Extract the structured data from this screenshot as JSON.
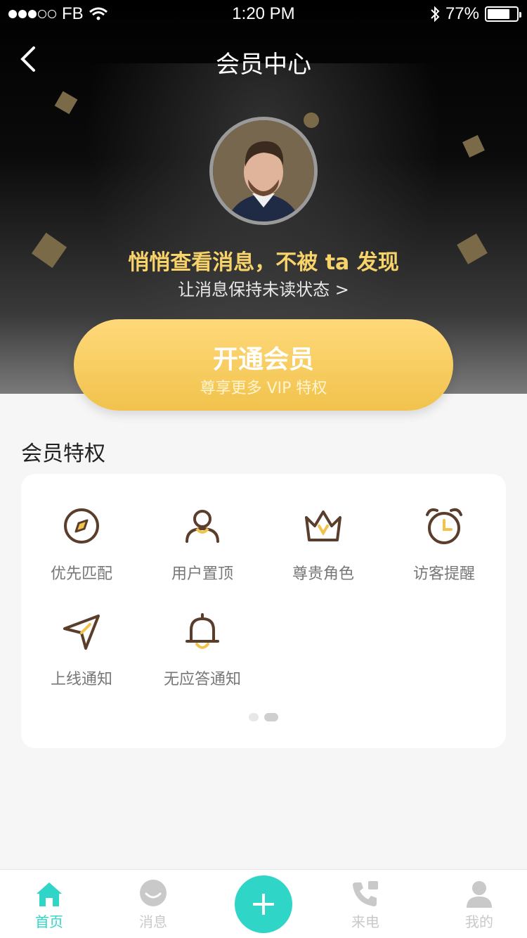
{
  "status_bar": {
    "carrier": "FB",
    "time": "1:20 PM",
    "battery": "77%"
  },
  "nav": {
    "title": "会员中心"
  },
  "hero": {
    "headline": "悄悄查看消息，不被 ta 发现",
    "subline": "让消息保持未读状态 >"
  },
  "cta": {
    "main": "开通会员",
    "sub": "尊享更多 VIP 特权"
  },
  "section_title": "会员特权",
  "privileges": [
    {
      "label": "优先匹配",
      "icon": "compass-icon"
    },
    {
      "label": "用户置顶",
      "icon": "user-icon"
    },
    {
      "label": "尊贵角色",
      "icon": "crown-icon"
    },
    {
      "label": "访客提醒",
      "icon": "alarm-clock-icon"
    },
    {
      "label": "上线通知",
      "icon": "send-icon"
    },
    {
      "label": "无应答通知",
      "icon": "bell-icon"
    }
  ],
  "tabbar": {
    "home": "首页",
    "messages": "消息",
    "calls": "来电",
    "mine": "我的"
  },
  "colors": {
    "accent": "#2fd5c6",
    "gold": "#f1c24c",
    "icon_brown": "#5a3d2b"
  }
}
